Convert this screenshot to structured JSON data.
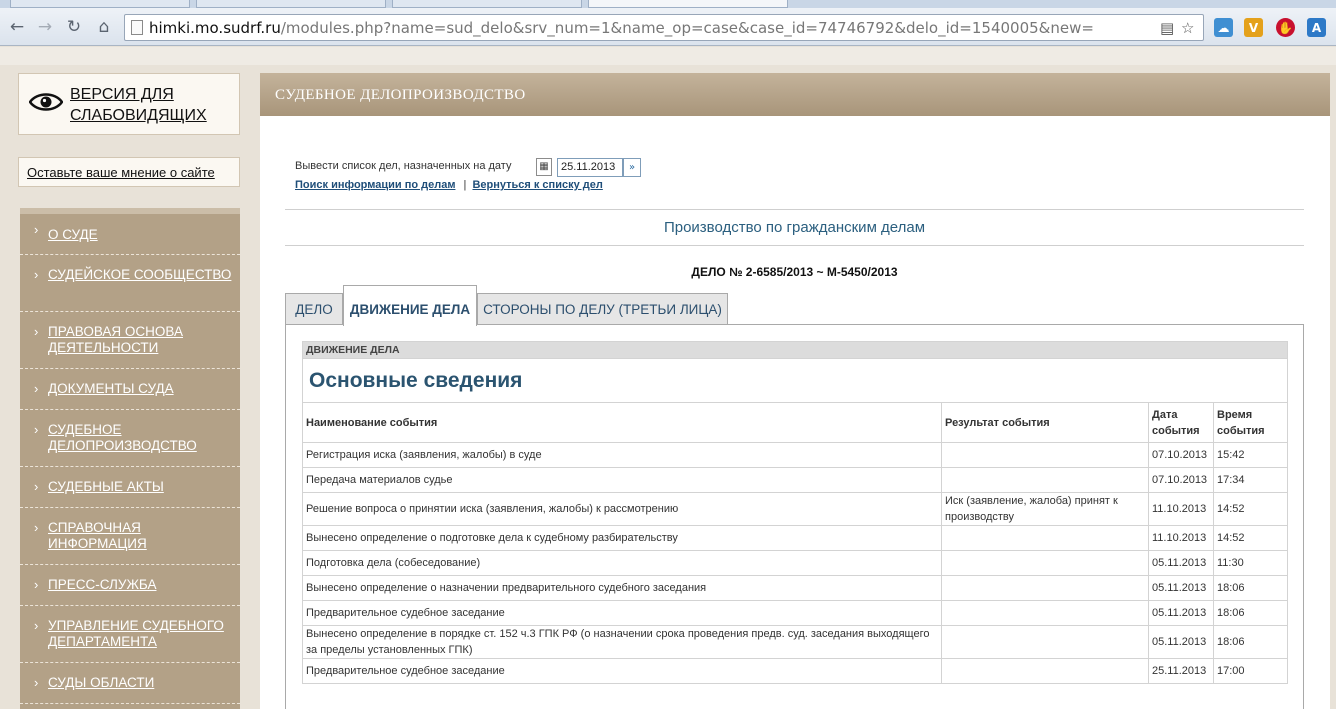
{
  "browser": {
    "url_host": "himki.mo.sudrf.ru",
    "url_path": "/modules.php?name=sud_delo&srv_num=1&name_op=case&case_id=74746792&delo_id=1540005&new="
  },
  "sidebar": {
    "low_vision_label": "ВЕРСИЯ ДЛЯ СЛАБОВИДЯЩИХ",
    "feedback_label": "Оставьте ваше мнение о сайте",
    "menu": [
      {
        "label": "О СУДЕ"
      },
      {
        "label": "СУДЕЙСКОЕ СООБЩЕСТВО"
      },
      {
        "label": "ПРАВОВАЯ ОСНОВА ДЕЯТЕЛЬНОСТИ"
      },
      {
        "label": "ДОКУМЕНТЫ СУДА"
      },
      {
        "label": "СУДЕБНОЕ ДЕЛОПРОИЗВОДСТВО"
      },
      {
        "label": "СУДЕБНЫЕ АКТЫ"
      },
      {
        "label": "СПРАВОЧНАЯ ИНФОРМАЦИЯ"
      },
      {
        "label": "ПРЕСС-СЛУЖБА"
      },
      {
        "label": "УПРАВЛЕНИЕ СУДЕБНОГО ДЕПАРТАМЕНТА"
      },
      {
        "label": "СУДЫ ОБЛАСТИ"
      }
    ]
  },
  "main": {
    "header": "СУДЕБНОЕ ДЕЛОПРОИЗВОДСТВО",
    "date_prompt": "Вывести список дел, назначенных на дату",
    "date_value": "25.11.2013",
    "link_search": "Поиск информации по делам",
    "link_separator": "|",
    "link_back": "Вернуться к списку дел",
    "section_title": "Производство по гражданским делам",
    "case_number": "ДЕЛО № 2-6585/2013 ~ М-5450/2013",
    "tabs": [
      {
        "label": "ДЕЛО",
        "active": false
      },
      {
        "label": "ДВИЖЕНИЕ ДЕЛА",
        "active": true
      },
      {
        "label": "СТОРОНЫ ПО ДЕЛУ (ТРЕТЬИ ЛИЦА)",
        "active": false
      }
    ],
    "table": {
      "caption": "ДВИЖЕНИЕ ДЕЛА",
      "title": "Основные сведения",
      "columns": [
        "Наименование события",
        "Результат события",
        "Дата события",
        "Время события"
      ],
      "rows": [
        {
          "event": "Регистрация иска (заявления, жалобы) в суде",
          "result": "",
          "date": "07.10.2013",
          "time": "15:42"
        },
        {
          "event": "Передача материалов судье",
          "result": "",
          "date": "07.10.2013",
          "time": "17:34"
        },
        {
          "event": "Решение вопроса о принятии иска (заявления, жалобы) к рассмотрению",
          "result": "Иск (заявление, жалоба) принят к производству",
          "date": "11.10.2013",
          "time": "14:52"
        },
        {
          "event": "Вынесено определение о подготовке дела к судебному разбирательству",
          "result": "",
          "date": "11.10.2013",
          "time": "14:52"
        },
        {
          "event": "Подготовка дела (собеседование)",
          "result": "",
          "date": "05.11.2013",
          "time": "11:30"
        },
        {
          "event": "Вынесено определение о назначении предварительного судебного заседания",
          "result": "",
          "date": "05.11.2013",
          "time": "18:06"
        },
        {
          "event": "Предварительное судебное заседание",
          "result": "",
          "date": "05.11.2013",
          "time": "18:06"
        },
        {
          "event": "Вынесено определение в порядке ст. 152 ч.3 ГПК РФ (о назначении срока проведения предв. суд. заседания выходящего за пределы установленных ГПК)",
          "result": "",
          "date": "05.11.2013",
          "time": "18:06"
        },
        {
          "event": "Предварительное судебное заседание",
          "result": "",
          "date": "25.11.2013",
          "time": "17:00"
        }
      ]
    }
  }
}
